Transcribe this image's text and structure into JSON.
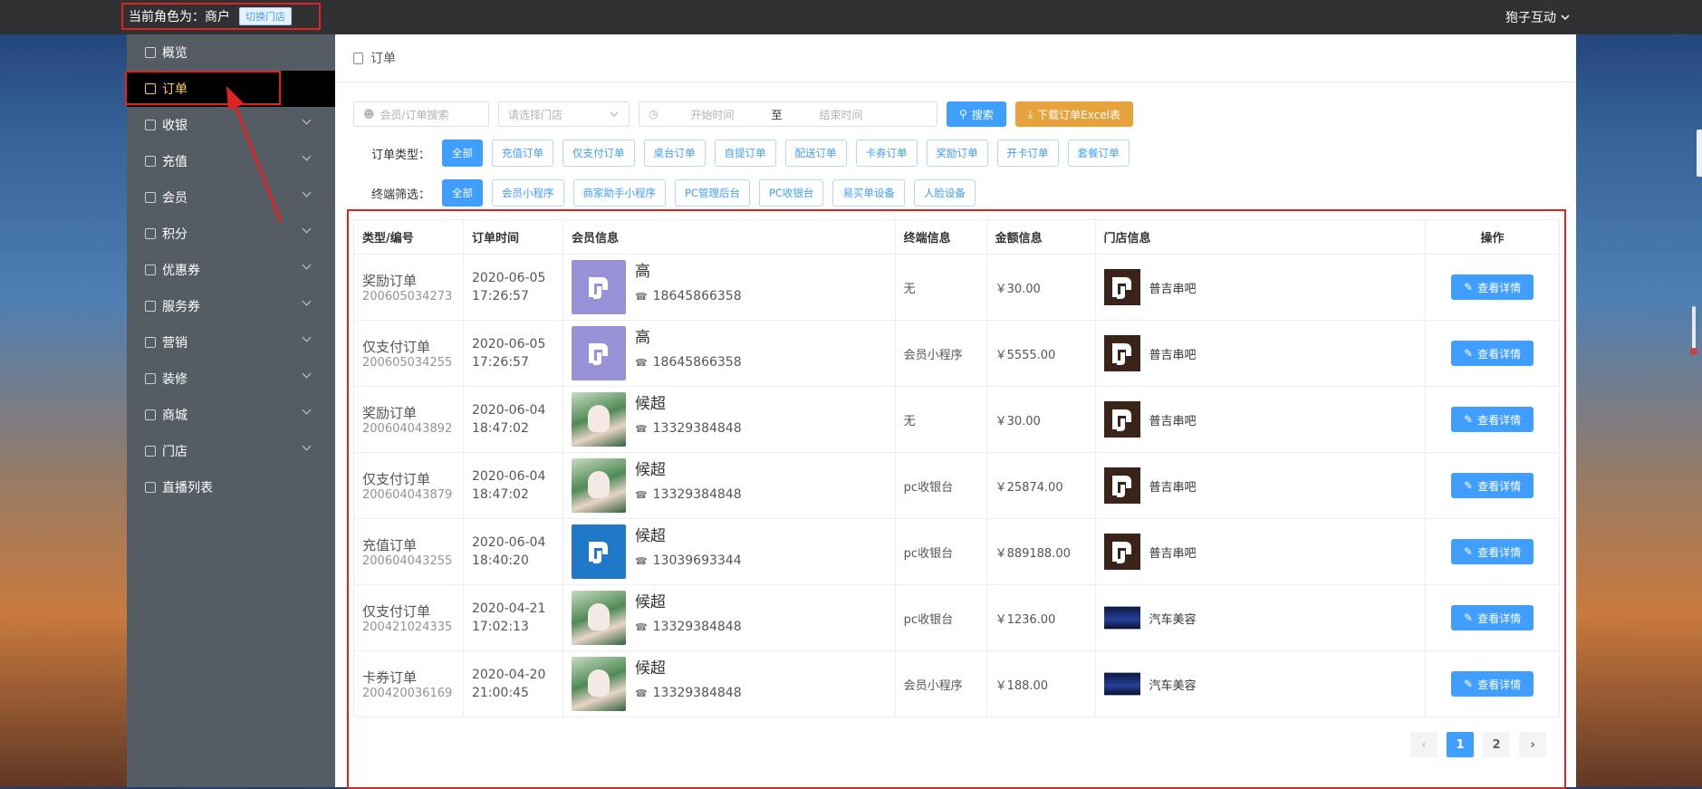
{
  "header": {
    "role_text": "当前角色为：商户",
    "switch_store": "切换门店",
    "user_name": "狍子互动"
  },
  "sidebar": {
    "items": [
      {
        "label": "概览",
        "icon": "home-icon",
        "has_arrow": false
      },
      {
        "label": "订单",
        "icon": "order-icon",
        "has_arrow": false,
        "active": true
      },
      {
        "label": "收银",
        "icon": "cashier-icon",
        "has_arrow": true
      },
      {
        "label": "充值",
        "icon": "recharge-icon",
        "has_arrow": true
      },
      {
        "label": "会员",
        "icon": "member-icon",
        "has_arrow": true
      },
      {
        "label": "积分",
        "icon": "points-icon",
        "has_arrow": true
      },
      {
        "label": "优惠券",
        "icon": "coupon-icon",
        "has_arrow": true
      },
      {
        "label": "服务券",
        "icon": "service-coupon-icon",
        "has_arrow": true
      },
      {
        "label": "营销",
        "icon": "marketing-icon",
        "has_arrow": true
      },
      {
        "label": "装修",
        "icon": "decoration-icon",
        "has_arrow": true
      },
      {
        "label": "商城",
        "icon": "mall-icon",
        "has_arrow": true
      },
      {
        "label": "门店",
        "icon": "store-icon",
        "has_arrow": true
      },
      {
        "label": "直播列表",
        "icon": "live-list-icon",
        "has_arrow": false
      }
    ]
  },
  "breadcrumb": {
    "title": "订单"
  },
  "search": {
    "member_placeholder": "会员/订单搜索",
    "store_placeholder": "请选择门店",
    "start_placeholder": "开始时间",
    "range_sep": "至",
    "end_placeholder": "结束时间",
    "search_label": "搜索",
    "download_label": "下载订单Excel表"
  },
  "filters": {
    "type_label": "订单类型：",
    "types": [
      "全部",
      "充值订单",
      "仅支付订单",
      "桌台订单",
      "自提订单",
      "配送订单",
      "卡券订单",
      "奖励订单",
      "开卡订单",
      "套餐订单"
    ],
    "terminal_label": "终端筛选：",
    "terminals": [
      "全部",
      "会员小程序",
      "商家助手小程序",
      "PC管理后台",
      "PC收银台",
      "易买单设备",
      "人脸设备"
    ]
  },
  "table": {
    "headers": [
      "类型/编号",
      "订单时间",
      "会员信息",
      "终端信息",
      "金额信息",
      "门店信息",
      "操作"
    ],
    "action_label": "查看详情",
    "rows": [
      {
        "type": "奖励订单",
        "no": "200605034273",
        "date": "2020-06-05",
        "time": "17:26:57",
        "name": "高",
        "phone": "18645866358",
        "avatar": "logo",
        "terminal": "无",
        "amount": "￥30.00",
        "store": "普吉串吧",
        "store_logo": "pj"
      },
      {
        "type": "仅支付订单",
        "no": "200605034255",
        "date": "2020-06-05",
        "time": "17:26:57",
        "name": "高",
        "phone": "18645866358",
        "avatar": "logo",
        "terminal": "会员小程序",
        "amount": "￥5555.00",
        "store": "普吉串吧",
        "store_logo": "pj"
      },
      {
        "type": "奖励订单",
        "no": "200604043892",
        "date": "2020-06-04",
        "time": "18:47:02",
        "name": "候超",
        "phone": "13329384848",
        "avatar": "photo",
        "terminal": "无",
        "amount": "￥30.00",
        "store": "普吉串吧",
        "store_logo": "pj"
      },
      {
        "type": "仅支付订单",
        "no": "200604043879",
        "date": "2020-06-04",
        "time": "18:47:02",
        "name": "候超",
        "phone": "13329384848",
        "avatar": "photo",
        "terminal": "pc收银台",
        "amount": "￥25874.00",
        "store": "普吉串吧",
        "store_logo": "pj"
      },
      {
        "type": "充值订单",
        "no": "200604043255",
        "date": "2020-06-04",
        "time": "18:40:20",
        "name": "候超",
        "phone": "13039693344",
        "avatar": "logo-blue",
        "terminal": "pc收银台",
        "amount": "￥889188.00",
        "store": "普吉串吧",
        "store_logo": "pj"
      },
      {
        "type": "仅支付订单",
        "no": "200421024335",
        "date": "2020-04-21",
        "time": "17:02:13",
        "name": "候超",
        "phone": "13329384848",
        "avatar": "photo",
        "terminal": "pc收银台",
        "amount": "￥1236.00",
        "store": "汽车美容",
        "store_logo": "car"
      },
      {
        "type": "卡券订单",
        "no": "200420036169",
        "date": "2020-04-20",
        "time": "21:00:45",
        "name": "候超",
        "phone": "13329384848",
        "avatar": "photo",
        "terminal": "会员小程序",
        "amount": "￥188.00",
        "store": "汽车美容",
        "store_logo": "car"
      }
    ]
  },
  "pagination": {
    "pages": [
      "1",
      "2"
    ],
    "current": "1"
  },
  "colors": {
    "accent": "#409eff",
    "warning": "#e6a23c",
    "annotation": "#e02222",
    "sidebar_bg": "#545c64",
    "active_text": "#ffd04b"
  }
}
